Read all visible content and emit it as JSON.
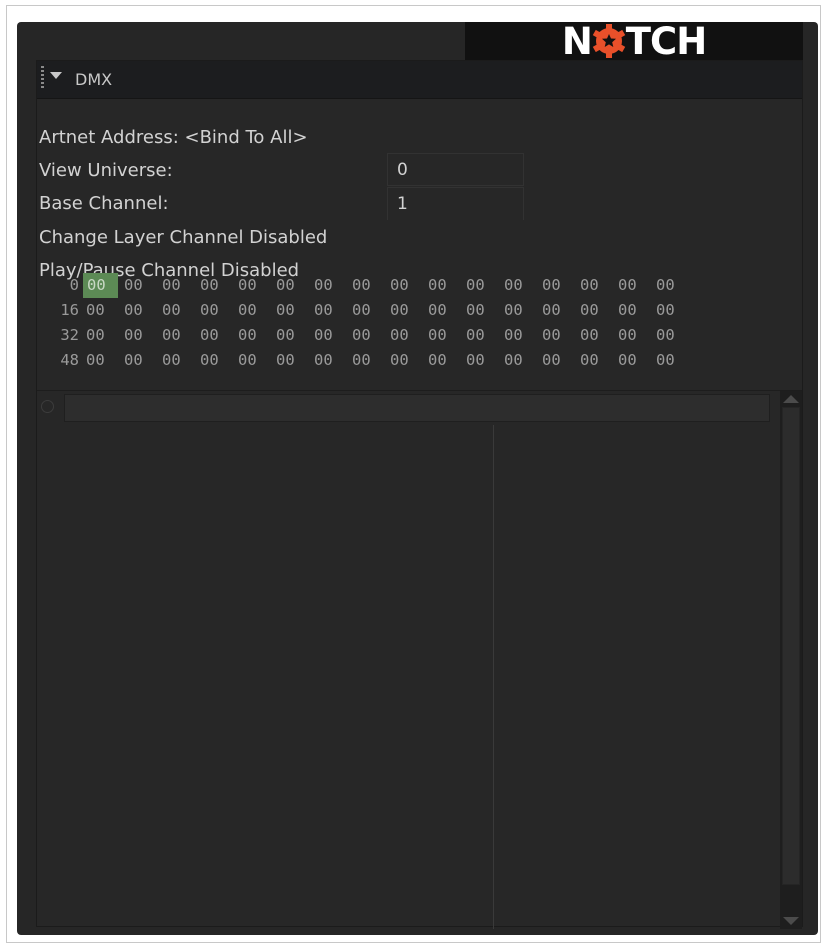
{
  "logo": {
    "text_before": "N",
    "text_after": "TCH",
    "cog_icon": "gear-icon",
    "accent": "#e8502a"
  },
  "panel": {
    "title": "DMX"
  },
  "fields": {
    "artnet_label": "Artnet Address: <Bind To All>",
    "view_universe_label": "View Universe:",
    "view_universe_value": "0",
    "base_channel_label": "Base Channel:",
    "base_channel_value": "1",
    "change_layer_label": "Change Layer Channel Disabled",
    "play_pause_label": "Play/Pause Channel Disabled"
  },
  "dmx": {
    "selected_color": "#5c8a55",
    "rows": [
      {
        "label": "0",
        "cells": [
          "00",
          "00",
          "00",
          "00",
          "00",
          "00",
          "00",
          "00",
          "00",
          "00",
          "00",
          "00",
          "00",
          "00",
          "00",
          "00"
        ]
      },
      {
        "label": "16",
        "cells": [
          "00",
          "00",
          "00",
          "00",
          "00",
          "00",
          "00",
          "00",
          "00",
          "00",
          "00",
          "00",
          "00",
          "00",
          "00",
          "00"
        ]
      },
      {
        "label": "32",
        "cells": [
          "00",
          "00",
          "00",
          "00",
          "00",
          "00",
          "00",
          "00",
          "00",
          "00",
          "00",
          "00",
          "00",
          "00",
          "00",
          "00"
        ]
      },
      {
        "label": "48",
        "cells": [
          "00",
          "00",
          "00",
          "00",
          "00",
          "00",
          "00",
          "00",
          "00",
          "00",
          "00",
          "00",
          "00",
          "00",
          "00",
          "00"
        ]
      }
    ]
  }
}
